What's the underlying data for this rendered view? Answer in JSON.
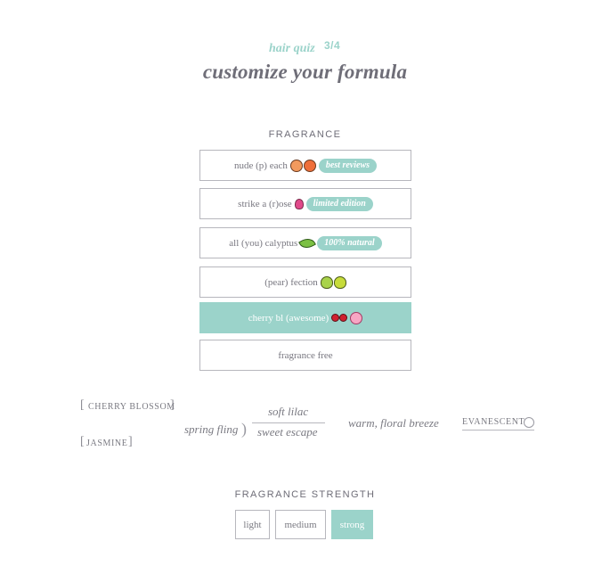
{
  "header": {
    "quiz_label": "hair quiz",
    "step": "3/4",
    "title": "customize your formula"
  },
  "fragrance": {
    "label": "FRAGRANCE",
    "options": [
      {
        "text": "nude (p) each",
        "icons": [
          "peach-icon",
          "peach-icon"
        ],
        "badge": "best reviews",
        "selected": false
      },
      {
        "text": "strike a (r)ose",
        "icons": [
          "rose-icon"
        ],
        "badge": "limited edition",
        "selected": false
      },
      {
        "text": "all (you) calyptus",
        "icons": [
          "leaf-icon"
        ],
        "badge": "100% natural",
        "selected": false
      },
      {
        "text": "(pear) fection",
        "icons": [
          "pear-icon",
          "pear-icon"
        ],
        "badge": "",
        "selected": false
      },
      {
        "text": "cherry bl (awesome)",
        "icons": [
          "cherries-icon",
          "blossom-icon"
        ],
        "badge": "",
        "selected": true
      },
      {
        "text": "fragrance free",
        "icons": [],
        "badge": "",
        "selected": false
      }
    ]
  },
  "notes": {
    "cherry_blossom": "CHERRY BLOSSOM",
    "jasmine": "JASMINE",
    "spring_fling": "spring fling",
    "soft_lilac": "soft lilac",
    "sweet_escape": "sweet escape",
    "floral_breeze": "warm, floral breeze",
    "evanescent": "EVANESCENT",
    "open_bracket": "[",
    "close_bracket": "]",
    "brace": ")"
  },
  "strength": {
    "label": "FRAGRANCE STRENGTH",
    "options": [
      {
        "label": "light",
        "selected": false
      },
      {
        "label": "medium",
        "selected": false
      },
      {
        "label": "strong",
        "selected": true
      }
    ]
  },
  "colors": {
    "accent": "#9bd3ca",
    "text": "#6f6e78",
    "border": "#b7b7bd"
  }
}
